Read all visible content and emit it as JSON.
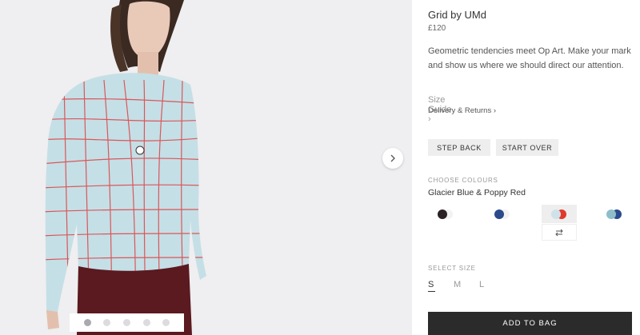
{
  "product": {
    "title": "Grid by UMd",
    "price": "£120",
    "description": "Geometric tendencies meet Op Art. Make your mark and show us where we should direct our attention."
  },
  "links": {
    "size_guide": "Size Guide ›",
    "delivery": "Delivery & Returns ›"
  },
  "buttons": {
    "step_back": "STEP BACK",
    "start_over": "START OVER",
    "add_to_bag": "ADD TO BAG"
  },
  "colours": {
    "label": "CHOOSE COLOURS",
    "selected_name": "Glacier Blue & Poppy Red",
    "swatches": [
      {
        "primary": "#2a2222",
        "secondary": "#f2f2f2",
        "selected": false
      },
      {
        "primary": "#2b4a8c",
        "secondary": "#f2f2f2",
        "selected": false
      },
      {
        "primary": "#cfe2ea",
        "secondary": "#e0392b",
        "selected": true
      },
      {
        "primary": "#8fbcc9",
        "secondary": "#2b4a8c",
        "selected": false
      }
    ]
  },
  "sizes": {
    "label": "SELECT SIZE",
    "options": [
      "S",
      "M",
      "L"
    ],
    "selected": "S"
  },
  "gallery": {
    "slide_count": 5,
    "active_slide": 1,
    "icons": [
      "chevron-right-icon",
      "swap-icon"
    ]
  }
}
